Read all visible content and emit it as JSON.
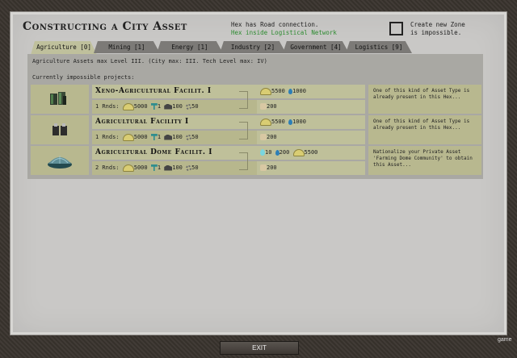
{
  "header": {
    "title": "Constructing a City Asset",
    "road_line1": "Hex has Road connection.",
    "road_line2": "Hex inside Logistical Network",
    "zone_line1": "Create new Zone",
    "zone_line2": "is impossible."
  },
  "tabs": [
    {
      "label": "Agriculture [0]"
    },
    {
      "label": "Mining [1]"
    },
    {
      "label": "Energy [1]"
    },
    {
      "label": "Industry [2]"
    },
    {
      "label": "Government [4]"
    },
    {
      "label": "Logistics [9]"
    }
  ],
  "info": {
    "max_level": "Agriculture Assets max Level III. (City max: III. Tech Level max: IV)",
    "impossible_header": "Currently impossible projects:"
  },
  "rows": [
    {
      "name": "Xeno-Agricultural Facilit. I",
      "rnds": "1 Rnds:",
      "cost_food": "5000",
      "cost_worker": "1",
      "cost_ind": "100",
      "cost_gear": "50",
      "out1_food": "5500",
      "out1_water": "1000",
      "out2_hand": "200",
      "message": "One of this kind of Asset Type is already present in this Hex..."
    },
    {
      "name": "Agricultural Facility I",
      "rnds": "1 Rnds:",
      "cost_food": "5000",
      "cost_worker": "1",
      "cost_ind": "100",
      "cost_gear": "50",
      "out1_food": "5500",
      "out1_water": "1000",
      "out2_hand": "200",
      "message": "One of this kind of Asset Type is already present in this Hex..."
    },
    {
      "name": "Agricultural Dome Facilit. I",
      "rnds": "2 Rnds:",
      "cost_food": "5000",
      "cost_worker": "1",
      "cost_ind": "100",
      "cost_gear": "50",
      "out1_water2": "10",
      "out1_water": "200",
      "out1_food": "5500",
      "out2_hand": "200",
      "message": "Nationalize your Private Asset 'Farming Dome Community' to obtain this Asset..."
    }
  ],
  "footer": {
    "exit_label": "EXIT",
    "game_label": "game"
  }
}
